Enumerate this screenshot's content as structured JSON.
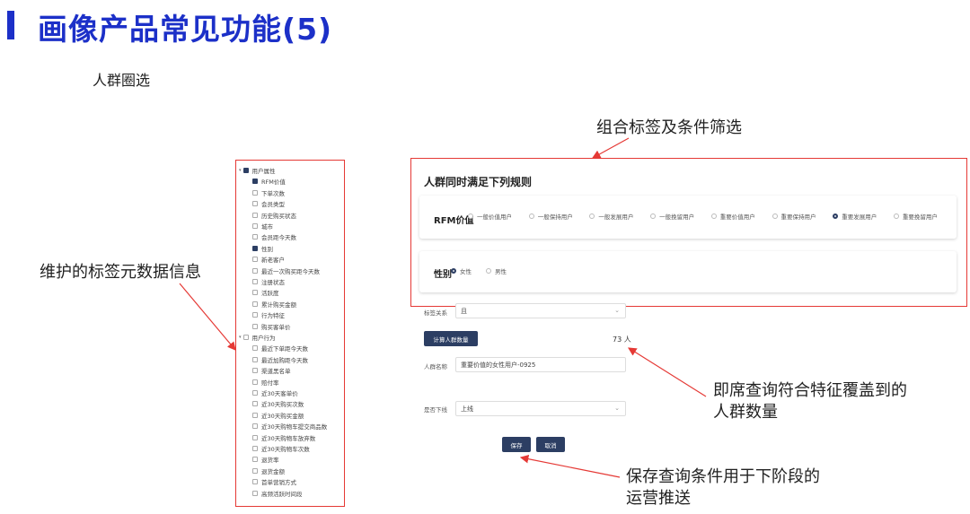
{
  "slide": {
    "title": "画像产品常见功能(5)",
    "subtitle": "人群圈选"
  },
  "annotations": {
    "tag_meta": "维护的标签元数据信息",
    "combo_filter": "组合标签及条件筛选",
    "instant_query_line1": "即席查询符合特征覆盖到的",
    "instant_query_line2": "人群数量",
    "save_line1": "保存查询条件用于下阶段的",
    "save_line2": "运营推送"
  },
  "tree": {
    "items": [
      {
        "label": "用户属性",
        "level": 0,
        "checked": true
      },
      {
        "label": "RFM价值",
        "level": 1,
        "checked": true
      },
      {
        "label": "下单次数",
        "level": 1,
        "checked": false
      },
      {
        "label": "会员类型",
        "level": 1,
        "checked": false
      },
      {
        "label": "历史购买状态",
        "level": 1,
        "checked": false
      },
      {
        "label": "城市",
        "level": 1,
        "checked": false
      },
      {
        "label": "会员距今天数",
        "level": 1,
        "checked": false
      },
      {
        "label": "性别",
        "level": 1,
        "checked": true
      },
      {
        "label": "新老客户",
        "level": 1,
        "checked": false
      },
      {
        "label": "最近一次购买距今天数",
        "level": 1,
        "checked": false
      },
      {
        "label": "注册状态",
        "level": 1,
        "checked": false
      },
      {
        "label": "活跃度",
        "level": 1,
        "checked": false
      },
      {
        "label": "累计购买金额",
        "level": 1,
        "checked": false
      },
      {
        "label": "行为特征",
        "level": 1,
        "checked": false
      },
      {
        "label": "购买客单价",
        "level": 1,
        "checked": false
      },
      {
        "label": "用户行为",
        "level": 0,
        "checked": false
      },
      {
        "label": "最近下单距今天数",
        "level": 1,
        "checked": false
      },
      {
        "label": "最近加购距今天数",
        "level": 1,
        "checked": false
      },
      {
        "label": "渠道黑名单",
        "level": 1,
        "checked": false
      },
      {
        "label": "赔付率",
        "level": 1,
        "checked": false
      },
      {
        "label": "近30天客单价",
        "level": 1,
        "checked": false
      },
      {
        "label": "近30天购买次数",
        "level": 1,
        "checked": false
      },
      {
        "label": "近30天购买金额",
        "level": 1,
        "checked": false
      },
      {
        "label": "近30天购物车提交商品数",
        "level": 1,
        "checked": false
      },
      {
        "label": "近30天购物车放弃数",
        "level": 1,
        "checked": false
      },
      {
        "label": "近30天购物车次数",
        "level": 1,
        "checked": false
      },
      {
        "label": "退货率",
        "level": 1,
        "checked": false
      },
      {
        "label": "退货金额",
        "level": 1,
        "checked": false
      },
      {
        "label": "首单营销方式",
        "level": 1,
        "checked": false
      },
      {
        "label": "高频活跃时间段",
        "level": 1,
        "checked": false
      }
    ]
  },
  "rules": {
    "heading": "人群同时满足下列规则",
    "rfm_label": "RFM价值",
    "rfm_options": [
      {
        "label": "一般价值用户",
        "selected": false
      },
      {
        "label": "一般保持用户",
        "selected": false
      },
      {
        "label": "一般发展用户",
        "selected": false
      },
      {
        "label": "一般挽留用户",
        "selected": false
      },
      {
        "label": "重要价值用户",
        "selected": false
      },
      {
        "label": "重要保持用户",
        "selected": false
      },
      {
        "label": "重要发展用户",
        "selected": true
      },
      {
        "label": "重要挽留用户",
        "selected": false
      }
    ],
    "gender_label": "性别",
    "gender_options": [
      {
        "label": "女性",
        "selected": true
      },
      {
        "label": "男性",
        "selected": false
      }
    ]
  },
  "form": {
    "relation_label": "标签关系",
    "relation_value": "且",
    "compute_button": "计算人群数量",
    "count_value": "73 人",
    "name_label": "人群名称",
    "name_value": "重要价值的女性用户-0925",
    "offline_label": "是否下线",
    "offline_value": "上线",
    "save_button": "保存",
    "cancel_button": "取消"
  },
  "colors": {
    "title_blue": "#1c30c8",
    "annotation_red": "#e53935",
    "button_navy": "#2c3e63"
  }
}
